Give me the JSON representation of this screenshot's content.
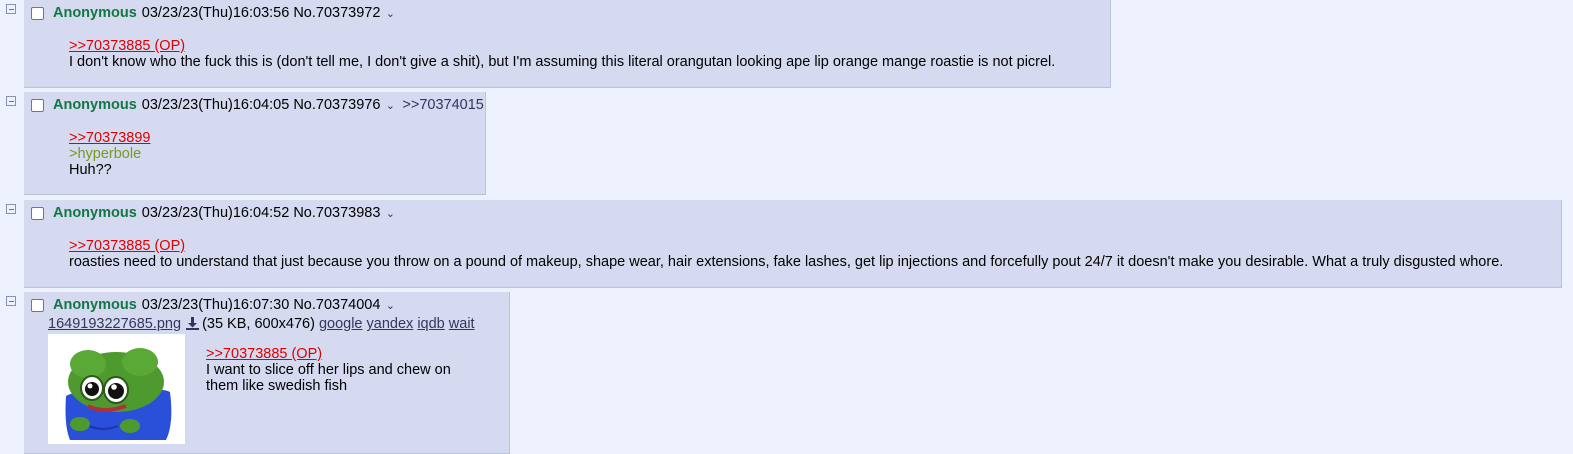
{
  "posts": [
    {
      "name": "Anonymous",
      "date": "03/23/23(Thu)16:03:56",
      "no": "No.70373972",
      "quote": ">>70373885 (OP)",
      "text": "I don't know who the fuck this is (don't tell me, I don't give a shit), but I'm assuming this literal orangutan looking ape lip orange mange roastie is not picrel."
    },
    {
      "name": "Anonymous",
      "date": "03/23/23(Thu)16:04:05",
      "no": "No.70373976",
      "backlink": ">>70374015",
      "quote": ">>70373899",
      "greentext": ">hyperbole",
      "text": "Huh??"
    },
    {
      "name": "Anonymous",
      "date": "03/23/23(Thu)16:04:52",
      "no": "No.70373983",
      "quote": ">>70373885 (OP)",
      "text": "roasties need to understand that just because you throw on a pound of makeup, shape wear, hair extensions, fake lashes, get lip injections and forcefully pout 24/7 it doesn't make you desirable. What a truly disgusted whore."
    },
    {
      "name": "Anonymous",
      "date": "03/23/23(Thu)16:07:30",
      "no": "No.70374004",
      "file": {
        "filename": "1649193227685.png",
        "meta": "(35 KB, 600x476)",
        "search_links": [
          "google",
          "yandex",
          "iqdb",
          "wait"
        ]
      },
      "quote": ">>70373885 (OP)",
      "text_lines": [
        "I want to slice off her lips and chew on",
        "them like swedish fish"
      ]
    }
  ],
  "icons": {
    "hide": "minus-box-icon",
    "menu": "chevron-down-icon",
    "download": "download-icon"
  },
  "colors": {
    "background": "#eef2ff",
    "post": "#d6daf0",
    "name": "#117743",
    "quotelink": "#dd0000",
    "greentext": "#789922",
    "link": "#34345c"
  }
}
